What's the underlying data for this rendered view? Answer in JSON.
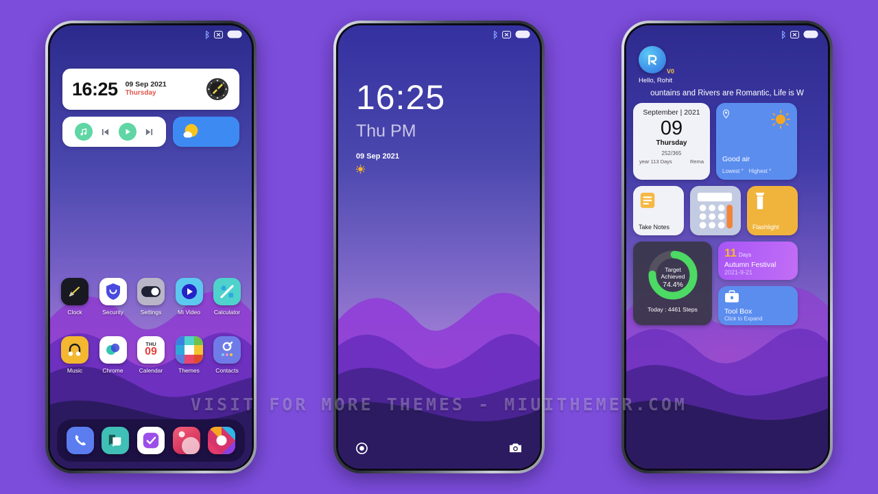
{
  "watermark": "VISIT FOR MORE THEMES - MIUITHEMER.COM",
  "colors": {
    "page_background": "#7c4ddb",
    "accent_blue": "#3d8bf2",
    "accent_green": "#5fd6a4",
    "accent_yellow": "#f5b841",
    "accent_purple": "#a855f7",
    "screen_top": "#2e2b8f"
  },
  "status_bar": {
    "icons": [
      "bluetooth-icon",
      "silent-mode-icon",
      "battery-icon"
    ]
  },
  "phone1": {
    "clock_widget": {
      "time": "16:25",
      "date": "09 Sep 2021",
      "weekday": "Thursday",
      "icon": "compass-icon"
    },
    "music_widget": {
      "icons": [
        "music-note-icon",
        "previous-track-icon",
        "play-icon",
        "next-track-icon"
      ]
    },
    "weather_widget": {
      "icon": "sun-cloud-icon"
    },
    "apps_row1": [
      {
        "label": "Clock",
        "icon": "clock-icon"
      },
      {
        "label": "Security",
        "icon": "shield-icon"
      },
      {
        "label": "Settings",
        "icon": "toggle-icon"
      },
      {
        "label": "Mi Video",
        "icon": "play-circle-icon"
      },
      {
        "label": "Calculator",
        "icon": "percent-icon"
      }
    ],
    "apps_row2": [
      {
        "label": "Music",
        "icon": "headphone-note-icon"
      },
      {
        "label": "Chrome",
        "icon": "chrome-circles-icon"
      },
      {
        "label": "Calendar",
        "icon": "calendar-icon",
        "day_name": "THU",
        "day_num": "09"
      },
      {
        "label": "Themes",
        "icon": "themes-grid-icon"
      },
      {
        "label": "Contacts",
        "icon": "contacts-icon"
      }
    ],
    "dock": [
      {
        "icon": "phone-icon"
      },
      {
        "icon": "messages-icon"
      },
      {
        "icon": "check-square-icon"
      },
      {
        "icon": "gallery-icon"
      },
      {
        "icon": "camera-pinwheel-icon"
      }
    ]
  },
  "phone2": {
    "time": "16:25",
    "ampm": "Thu PM",
    "date": "09 Sep 2021",
    "weather_icon": "sun-icon",
    "bottom_left_icon": "record-circle-icon",
    "bottom_right_icon": "camera-icon"
  },
  "phone3": {
    "avatar_letter": "R",
    "avatar_badge": "V0",
    "greeting": "Hello, Rohit",
    "quote": "ountains and Rivers are Romantic, Life is W",
    "calendar": {
      "month_year": "September | 2021",
      "day": "09",
      "weekday": "Thursday",
      "day_of_year": "252/365",
      "elapsed": "year 113 Days",
      "remaining": "Rema"
    },
    "weather": {
      "location_icon": "location-pin-icon",
      "sun_icon": "sun-icon",
      "air_quality": "Good air",
      "lowest": "Lowest °",
      "highest": "Highest °"
    },
    "shortcuts": [
      {
        "label": "Take Notes",
        "icon": "notes-icon",
        "bg": "#f1f1f8",
        "fg": "#222222"
      },
      {
        "label": "",
        "icon": "calculator-icon",
        "bg": "#c3cbe2",
        "fg": "#ffffff"
      },
      {
        "label": "Flashlight",
        "icon": "flashlight-icon",
        "bg": "#f0b43c",
        "fg": "#ffffff"
      }
    ],
    "steps": {
      "title": "Target",
      "title2": "Achieved",
      "percent": "74.4%",
      "caption": "Today : 4461 Steps",
      "ring_color": "#4cd964",
      "progress": 74.4
    },
    "festival": {
      "days": "11",
      "days_label": "Days",
      "title": "Autumn Festival",
      "date": "2021-9-21"
    },
    "toolbox": {
      "icon": "toolbox-icon",
      "title": "Tool Box",
      "subtitle": "Click to Expand"
    }
  }
}
